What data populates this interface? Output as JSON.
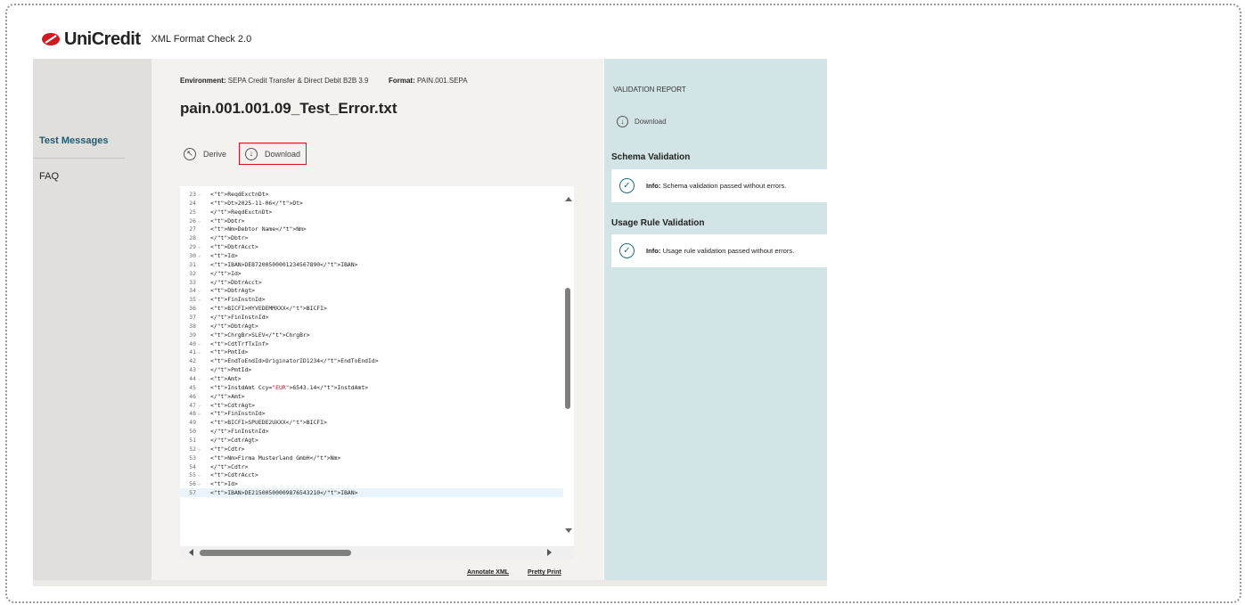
{
  "header": {
    "brand": "UniCredit",
    "app_title": "XML Format Check 2.0"
  },
  "sidebar": {
    "items": [
      {
        "label": "Test Messages",
        "active": true
      },
      {
        "label": "FAQ",
        "active": false
      }
    ]
  },
  "main": {
    "env_label": "Environment:",
    "env_value": "SEPA Credit Transfer & Direct Debit B2B 3.9",
    "format_label": "Format:",
    "format_value": "PAIN.001.SEPA",
    "filename": "pain.001.001.09_Test_Error.txt",
    "actions": {
      "derive_label": "Derive",
      "download_label": "Download"
    }
  },
  "editor": {
    "lines": [
      {
        "n": "23",
        "fold": true,
        "code": "<ReqdExctnDt>"
      },
      {
        "n": "24",
        "fold": false,
        "code": "<Dt>2025-11-06</Dt>"
      },
      {
        "n": "25",
        "fold": false,
        "code": "</ReqdExctnDt>"
      },
      {
        "n": "26",
        "fold": true,
        "code": "<Dbtr>"
      },
      {
        "n": "27",
        "fold": false,
        "code": "<Nm>Debtor Name</Nm>"
      },
      {
        "n": "28",
        "fold": false,
        "code": "</Dbtr>"
      },
      {
        "n": "29",
        "fold": true,
        "code": "<DbtrAcct>"
      },
      {
        "n": "30",
        "fold": true,
        "code": "<Id>"
      },
      {
        "n": "31",
        "fold": false,
        "code": "<IBAN>DE87200500001234567890</IBAN>"
      },
      {
        "n": "32",
        "fold": false,
        "code": "</Id>"
      },
      {
        "n": "33",
        "fold": false,
        "code": "</DbtrAcct>"
      },
      {
        "n": "34",
        "fold": true,
        "code": "<DbtrAgt>"
      },
      {
        "n": "35",
        "fold": true,
        "code": "<FinInstnId>"
      },
      {
        "n": "36",
        "fold": false,
        "code": "<BICFI>HYVEDEMMXXX</BICFI>"
      },
      {
        "n": "37",
        "fold": false,
        "code": "</FinInstnId>"
      },
      {
        "n": "38",
        "fold": false,
        "code": "</DbtrAgt>"
      },
      {
        "n": "39",
        "fold": false,
        "code": "<ChrgBr>SLEV</ChrgBr>"
      },
      {
        "n": "40",
        "fold": true,
        "code": "<CdtTrfTxInf>"
      },
      {
        "n": "41",
        "fold": true,
        "code": "<PmtId>"
      },
      {
        "n": "42",
        "fold": false,
        "code": "<EndToEndId>OriginatorID1234</EndToEndId>"
      },
      {
        "n": "43",
        "fold": false,
        "code": "</PmtId>"
      },
      {
        "n": "44",
        "fold": true,
        "code": "<Amt>"
      },
      {
        "n": "45",
        "fold": false,
        "code": "<InstdAmt Ccy=\"EUR\">6543.14</InstdAmt>"
      },
      {
        "n": "46",
        "fold": false,
        "code": "</Amt>"
      },
      {
        "n": "47",
        "fold": true,
        "code": "<CdtrAgt>"
      },
      {
        "n": "48",
        "fold": true,
        "code": "<FinInstnId>"
      },
      {
        "n": "49",
        "fold": false,
        "code": "<BICFI>SPUEDE2UXXX</BICFI>"
      },
      {
        "n": "50",
        "fold": false,
        "code": "</FinInstnId>"
      },
      {
        "n": "51",
        "fold": false,
        "code": "</CdtrAgt>"
      },
      {
        "n": "52",
        "fold": true,
        "code": "<Cdtr>"
      },
      {
        "n": "53",
        "fold": false,
        "code": "<Nm>Firma Musterland GmbH</Nm>"
      },
      {
        "n": "54",
        "fold": false,
        "code": "</Cdtr>"
      },
      {
        "n": "55",
        "fold": true,
        "code": "<CdtrAcct>"
      },
      {
        "n": "56",
        "fold": true,
        "code": "<Id>"
      },
      {
        "n": "57",
        "fold": false,
        "code": "<IBAN>DE21500500009876543210</IBAN>",
        "current": true
      }
    ],
    "links": {
      "annotate": "Annotate XML",
      "pretty": "Pretty Print"
    }
  },
  "report": {
    "title": "VALIDATION REPORT",
    "download_label": "Download",
    "schema_title": "Schema Validation",
    "schema_info_label": "Info:",
    "schema_info_text": " Schema validation passed without errors.",
    "usage_title": "Usage Rule Validation",
    "usage_info_label": "Info:",
    "usage_info_text": " Usage rule validation passed without errors."
  },
  "colors": {
    "brand_red": "#d1191f",
    "accent_teal": "#1d5b72",
    "report_bg": "#d3e4e7",
    "sidebar_bg": "#e0dfdb"
  }
}
